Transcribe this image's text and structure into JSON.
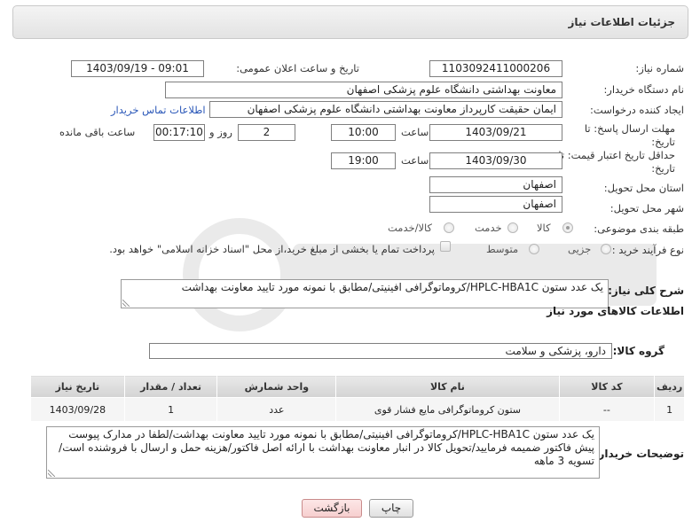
{
  "panel": {
    "title": "جزئیات اطلاعات نیاز"
  },
  "fields": {
    "need_number": {
      "label": "شماره نیاز:",
      "value": "1103092411000206"
    },
    "announce": {
      "label": "تاریخ و ساعت اعلان عمومی:",
      "value": "1403/09/19 - 09:01"
    },
    "buyer_org": {
      "label": "نام دستگاه خریدار:",
      "value": "معاونت بهداشتی دانشگاه علوم پزشکی اصفهان"
    },
    "requester": {
      "label": "ایجاد کننده درخواست:",
      "value": "ایمان حقیقت کارپرداز معاونت بهداشتی دانشگاه علوم پزشکی اصفهان",
      "contact_link": "اطلاعات تماس خریدار"
    },
    "reply_deadline": {
      "label": "مهلت ارسال پاسخ: تا تاریخ:",
      "date": "1403/09/21",
      "time_label": "ساعت",
      "time": "10:00",
      "days": "2",
      "days_label": "روز و",
      "remaining": "00:17:10",
      "remaining_label": "ساعت باقی مانده"
    },
    "price_validity": {
      "label": "حداقل تاریخ اعتبار قیمت: تا تاریخ:",
      "date": "1403/09/30",
      "time_label": "ساعت",
      "time": "19:00"
    },
    "province": {
      "label": "استان محل تحویل:",
      "value": "اصفهان"
    },
    "city": {
      "label": "شهر محل تحویل:",
      "value": "اصفهان"
    },
    "category": {
      "label": "طبقه بندی موضوعی:",
      "options": [
        "کالا",
        "خدمت",
        "کالا/خدمت"
      ]
    },
    "purchase_type": {
      "label": "نوع فرآیند خرید :",
      "options": [
        "جزیی",
        "متوسط"
      ],
      "payment_note": "پرداخت تمام یا بخشی از مبلغ خرید،از محل \"اسناد خزانه اسلامی\" خواهد بود."
    }
  },
  "summary": {
    "label": "شرح کلی نیاز:",
    "value": "یک عدد ستون HPLC-HBA1C/کروماتوگرافی افینیتی/مطابق با نمونه مورد تایید معاونت بهداشت"
  },
  "goods_section": {
    "title": "اطلاعات کالاهای مورد نیاز",
    "group_label": "گروه کالا:",
    "group_value": "دارو، پزشکی و سلامت"
  },
  "table": {
    "headers": [
      "ردیف",
      "کد کالا",
      "نام کالا",
      "واحد شمارش",
      "تعداد / مقدار",
      "تاریخ نیاز"
    ],
    "rows": [
      [
        "1",
        "--",
        "ستون کروماتوگرافی مایع فشار قوی",
        "عدد",
        "1",
        "1403/09/28"
      ]
    ]
  },
  "buyer_notes": {
    "label": "توضیحات خریدار:",
    "value": "یک عدد ستون HPLC-HBA1C/کروماتوگرافی افینیتی/مطابق با نمونه مورد تایید معاونت بهداشت/لطفا در مدارک پیوست پیش فاکتور ضمیمه فرمایید/تحویل کالا در انبار معاونت بهداشت با ارائه اصل فاکتور/هزینه حمل و ارسال با فروشنده است/تسویه 3 ماهه"
  },
  "buttons": {
    "print": "چاپ",
    "back": "بازگشت"
  },
  "colors": {
    "link": "#2a57b8",
    "back_button": "#f6cfcf"
  },
  "icons": {
    "watermark": "ariatender-logo"
  }
}
